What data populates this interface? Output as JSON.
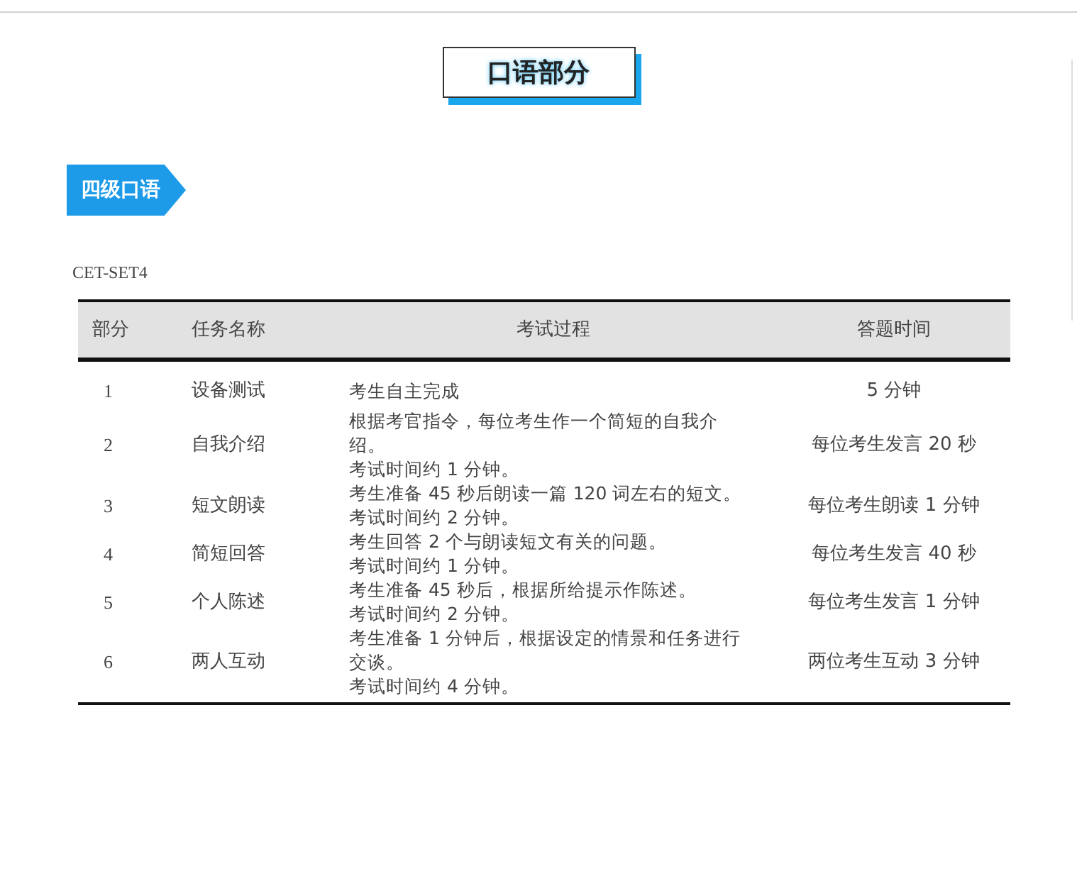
{
  "section_title": "口语部分",
  "level_tag": "四级口语",
  "table_caption": "CET-SET4",
  "table": {
    "columns": [
      "部分",
      "任务名称",
      "考试过程",
      "答题时间"
    ],
    "rows": [
      {
        "part": "1",
        "task": "设备测试",
        "process": [
          "考生自主完成"
        ],
        "time": "5 分钟"
      },
      {
        "part": "2",
        "task": "自我介绍",
        "process": [
          "根据考官指令，每位考生作一个简短的自我介",
          "绍。",
          "考试时间约 1 分钟。"
        ],
        "time": "每位考生发言 20 秒"
      },
      {
        "part": "3",
        "task": "短文朗读",
        "process": [
          "考生准备 45 秒后朗读一篇 120 词左右的短文。",
          "考试时间约 2 分钟。"
        ],
        "time": "每位考生朗读 1 分钟"
      },
      {
        "part": "4",
        "task": "简短回答",
        "process": [
          "考生回答 2 个与朗读短文有关的问题。",
          "考试时间约 1 分钟。"
        ],
        "time": "每位考生发言 40 秒"
      },
      {
        "part": "5",
        "task": "个人陈述",
        "process": [
          "考生准备 45 秒后，根据所给提示作陈述。",
          "考试时间约 2 分钟。"
        ],
        "time": "每位考生发言 1 分钟"
      },
      {
        "part": "6",
        "task": "两人互动",
        "process": [
          "考生准备 1 分钟后，根据设定的情景和任务进行",
          "交谈。",
          "考试时间约 4 分钟。"
        ],
        "time": "两位考生互动 3 分钟"
      }
    ]
  }
}
